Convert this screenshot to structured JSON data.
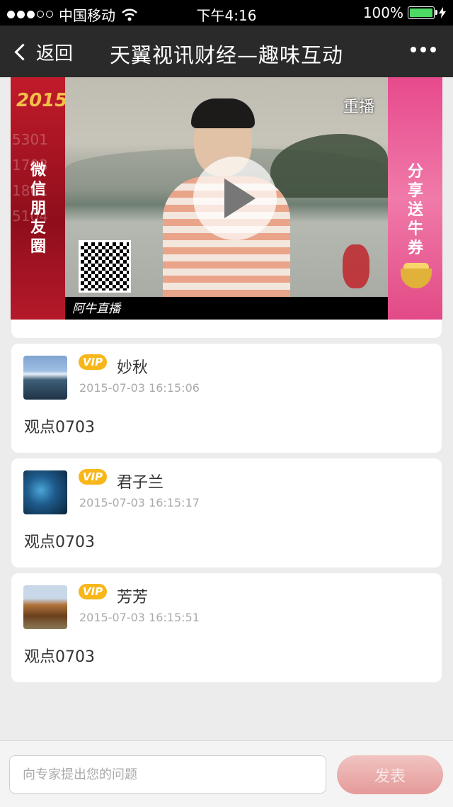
{
  "status_bar": {
    "carrier": "中国移动",
    "time": "下午4:16",
    "battery": "100%",
    "signal_dots_filled": 3,
    "signal_dots_total": 5
  },
  "nav": {
    "back_label": "返回",
    "title": "天翼视讯财经—趣味互动"
  },
  "video": {
    "replay_label": "重播",
    "left_banner_logo": "2015",
    "left_banner_text": "微信朋友圈",
    "right_banner_text": "分享送牛券",
    "signature_text": "阿牛直播"
  },
  "feed": [
    {
      "name": "妙秋",
      "vip_label": "VIP",
      "time": "2015-07-03 16:15:06",
      "content": "观点0703"
    },
    {
      "name": "君子兰",
      "vip_label": "VIP",
      "time": "2015-07-03 16:15:17",
      "content": "观点0703"
    },
    {
      "name": "芳芳",
      "vip_label": "VIP",
      "time": "2015-07-03 16:15:51",
      "content": "观点0703"
    }
  ],
  "composer": {
    "placeholder": "向专家提出您的问题",
    "send_label": "发表"
  },
  "colors": {
    "nav_bg": "#2a2a2a",
    "vip_badge": "#f7b71a",
    "send_button": "#e59a98",
    "battery": "#4cd964"
  }
}
